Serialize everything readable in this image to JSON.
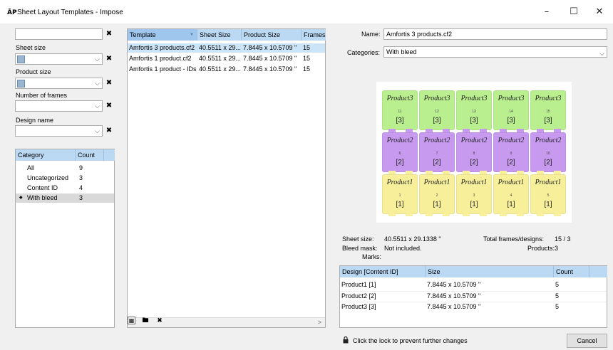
{
  "window": {
    "icon_text": "ĀP",
    "title": "Sheet Layout Templates - Impose",
    "minimize": "–",
    "maximize": "☐",
    "close": "✕"
  },
  "filters": {
    "search_value": "",
    "clear_symbol": "✖",
    "chevron_symbol": "⌵",
    "sheet_size_label": "Sheet size",
    "product_size_label": "Product size",
    "frames_label": "Number of frames",
    "design_name_label": "Design name"
  },
  "categories": {
    "headers": [
      "Category",
      "Count"
    ],
    "rows": [
      {
        "name": "All",
        "count": "9"
      },
      {
        "name": "Uncategorized",
        "count": "3"
      },
      {
        "name": "Content ID",
        "count": "4"
      },
      {
        "name": "With bleed",
        "count": "3",
        "marker": "◆"
      }
    ]
  },
  "templates": {
    "headers": [
      "Template",
      "Sheet Size",
      "Product Size",
      "Frames"
    ],
    "sort_indicator": "▼",
    "rows": [
      {
        "template": "Amfortis 3 products.cf2",
        "sheet": "40.5511 x 29...",
        "product": "7.8445 x 10.5709 \"",
        "frames": "15"
      },
      {
        "template": "Amfortis 1 product.cf2",
        "sheet": "40.5511 x 29...",
        "product": "7.8445 x 10.5709 \"",
        "frames": "15"
      },
      {
        "template": "Amfortis 1 product - IDs",
        "sheet": "40.5511 x 29...",
        "product": "7.8445 x 10.5709 \"",
        "frames": "15"
      }
    ],
    "scroll_left": "<",
    "scroll_right": ">"
  },
  "toolbar": {
    "save_icon_glyph": "🖫",
    "folder_icon_glyph": "🖿",
    "delete_glyph": "✖"
  },
  "details": {
    "name_label": "Name:",
    "name_value": "Amfortis 3 products.cf2",
    "categories_label": "Categories:",
    "categories_value": "With bleed"
  },
  "preview": {
    "rows": [
      {
        "product": "Product3",
        "bleed_id": "[3]",
        "numbers": [
          "11",
          "12",
          "13",
          "14",
          "15"
        ],
        "fill": "#b9ef8f",
        "bump": "#c9a0f2"
      },
      {
        "product": "Product2",
        "bleed_id": "[2]",
        "numbers": [
          "6",
          "7",
          "8",
          "9",
          "10"
        ],
        "fill": "#c79af0",
        "bump": "#c9a0f2"
      },
      {
        "product": "Product1",
        "bleed_id": "[1]",
        "numbers": [
          "1",
          "2",
          "3",
          "4",
          "5"
        ],
        "fill": "#f7ef9a",
        "bump": "#f7ef9a"
      }
    ]
  },
  "info": {
    "sheet_size_label": "Sheet size:",
    "sheet_size_value": "40.5511 x 29.1338 \"",
    "bleed_mask_label": "Bleed mask:",
    "bleed_mask_value": "Not included.",
    "marks_label": "Marks:",
    "total_label": "Total frames/designs:",
    "total_value": "15  / 3",
    "products_label": "Products:",
    "products_value": "3"
  },
  "designs": {
    "headers": [
      "Design [Content ID]",
      "Size",
      "Count"
    ],
    "rows": [
      {
        "design": "Product1 [1]",
        "size": "7.8445 x 10.5709 \"",
        "count": "5"
      },
      {
        "design": "Product2 [2]",
        "size": "7.8445 x 10.5709 \"",
        "count": "5"
      },
      {
        "design": "Product3 [3]",
        "size": "7.8445 x 10.5709 \"",
        "count": "5"
      }
    ]
  },
  "footer": {
    "lock_text": "Click the lock to prevent further changes",
    "cancel_label": "Cancel"
  }
}
